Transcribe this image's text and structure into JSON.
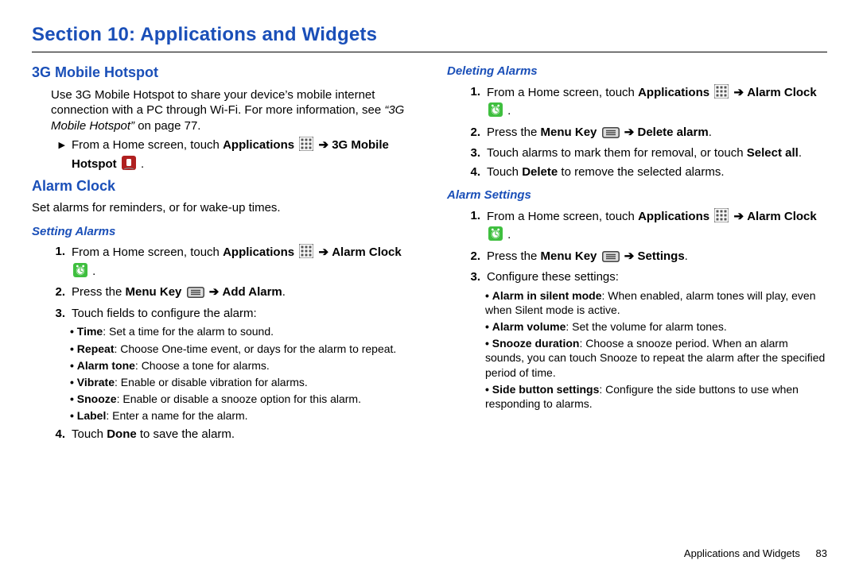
{
  "section_title": "Section 10: Applications and Widgets",
  "footer": {
    "label": "Applications and Widgets",
    "page": "83"
  },
  "icons": {
    "apps": "apps-grid-icon",
    "arrow": "➔",
    "hotspot": "hotspot-icon",
    "alarm": "alarm-clock-icon",
    "menu": "menu-key-icon"
  },
  "left": {
    "h_3g": "3G Mobile Hotspot",
    "p_3g_a": "Use 3G Mobile Hotspot to share your device’s mobile internet connection with a PC through Wi-Fi. For more information, see ",
    "p_3g_ref": "“3G Mobile Hotspot”",
    "p_3g_b": " on page 77.",
    "step3g_pre": "From a Home screen, touch ",
    "step3g_apps": "Applications",
    "step3g_mid": " ",
    "step3g_bold": "3G Mobile Hotspot",
    "h_alarm": "Alarm Clock",
    "p_alarm": "Set alarms for reminders, or for wake-up times.",
    "h_setting": "Setting Alarms",
    "s1_pre": "From a Home screen, touch ",
    "s1_apps": "Applications",
    "s1_ac": "Alarm Clock",
    "s2_pre": "Press the ",
    "s2_mk": "Menu Key",
    "s2_add": "Add Alarm",
    "s3": "Touch fields to configure the alarm:",
    "bullets": {
      "time_b": "Time",
      "time": ": Set a time for the alarm to sound.",
      "repeat_b": "Repeat",
      "repeat": ": Choose One-time event, or days for the alarm to repeat.",
      "tone_b": "Alarm tone",
      "tone": ": Choose a tone for alarms.",
      "vib_b": "Vibrate",
      "vib": ": Enable or disable vibration for alarms.",
      "snz_b": "Snooze",
      "snz": ": Enable or disable a snooze option for this alarm.",
      "lbl_b": "Label",
      "lbl": ": Enter a name for the alarm."
    },
    "s4_a": "Touch ",
    "s4_b": "Done",
    "s4_c": " to save the alarm."
  },
  "right": {
    "h_del": "Deleting Alarms",
    "d1_pre": "From a Home screen, touch ",
    "d1_apps": "Applications",
    "d1_ac": "Alarm Clock",
    "d2_pre": "Press the ",
    "d2_mk": "Menu Key",
    "d2_tgt": "Delete alarm",
    "d3_a": "Touch alarms to mark them for removal, or touch ",
    "d3_b": "Select all",
    "d4_a": "Touch ",
    "d4_b": "Delete",
    "d4_c": " to remove the selected alarms.",
    "h_set": "Alarm Settings",
    "a1_pre": "From a Home screen, touch ",
    "a1_apps": "Applications",
    "a1_ac": "Alarm Clock",
    "a2_pre": "Press the ",
    "a2_mk": "Menu Key",
    "a2_tgt": "Settings",
    "a3": "Configure these settings:",
    "bullets": {
      "sil_b": "Alarm in silent mode",
      "sil": ": When enabled, alarm tones will play, even when Silent mode is active.",
      "vol_b": "Alarm volume",
      "vol": ": Set the volume for alarm tones.",
      "snd_b": "Snooze duration",
      "snd": ": Choose a snooze period. When an alarm sounds, you can touch Snooze to repeat the alarm after the specified period of time.",
      "sbs_b": "Side button settings",
      "sbs": ": Configure the side buttons to use when responding to alarms."
    }
  }
}
